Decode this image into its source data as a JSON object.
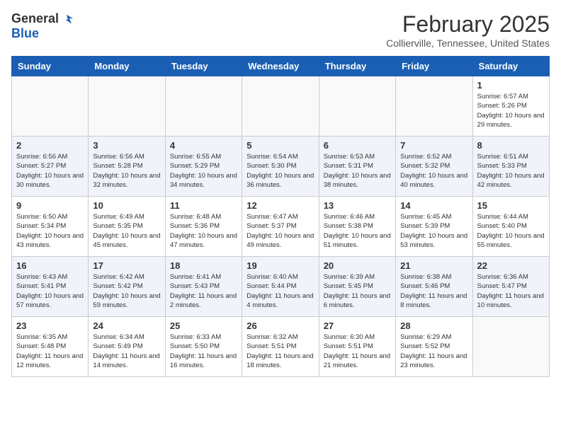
{
  "logo": {
    "general": "General",
    "blue": "Blue"
  },
  "title": "February 2025",
  "location": "Collierville, Tennessee, United States",
  "weekdays": [
    "Sunday",
    "Monday",
    "Tuesday",
    "Wednesday",
    "Thursday",
    "Friday",
    "Saturday"
  ],
  "weeks": [
    [
      {
        "day": "",
        "info": ""
      },
      {
        "day": "",
        "info": ""
      },
      {
        "day": "",
        "info": ""
      },
      {
        "day": "",
        "info": ""
      },
      {
        "day": "",
        "info": ""
      },
      {
        "day": "",
        "info": ""
      },
      {
        "day": "1",
        "info": "Sunrise: 6:57 AM\nSunset: 5:26 PM\nDaylight: 10 hours and 29 minutes."
      }
    ],
    [
      {
        "day": "2",
        "info": "Sunrise: 6:56 AM\nSunset: 5:27 PM\nDaylight: 10 hours and 30 minutes."
      },
      {
        "day": "3",
        "info": "Sunrise: 6:56 AM\nSunset: 5:28 PM\nDaylight: 10 hours and 32 minutes."
      },
      {
        "day": "4",
        "info": "Sunrise: 6:55 AM\nSunset: 5:29 PM\nDaylight: 10 hours and 34 minutes."
      },
      {
        "day": "5",
        "info": "Sunrise: 6:54 AM\nSunset: 5:30 PM\nDaylight: 10 hours and 36 minutes."
      },
      {
        "day": "6",
        "info": "Sunrise: 6:53 AM\nSunset: 5:31 PM\nDaylight: 10 hours and 38 minutes."
      },
      {
        "day": "7",
        "info": "Sunrise: 6:52 AM\nSunset: 5:32 PM\nDaylight: 10 hours and 40 minutes."
      },
      {
        "day": "8",
        "info": "Sunrise: 6:51 AM\nSunset: 5:33 PM\nDaylight: 10 hours and 42 minutes."
      }
    ],
    [
      {
        "day": "9",
        "info": "Sunrise: 6:50 AM\nSunset: 5:34 PM\nDaylight: 10 hours and 43 minutes."
      },
      {
        "day": "10",
        "info": "Sunrise: 6:49 AM\nSunset: 5:35 PM\nDaylight: 10 hours and 45 minutes."
      },
      {
        "day": "11",
        "info": "Sunrise: 6:48 AM\nSunset: 5:36 PM\nDaylight: 10 hours and 47 minutes."
      },
      {
        "day": "12",
        "info": "Sunrise: 6:47 AM\nSunset: 5:37 PM\nDaylight: 10 hours and 49 minutes."
      },
      {
        "day": "13",
        "info": "Sunrise: 6:46 AM\nSunset: 5:38 PM\nDaylight: 10 hours and 51 minutes."
      },
      {
        "day": "14",
        "info": "Sunrise: 6:45 AM\nSunset: 5:39 PM\nDaylight: 10 hours and 53 minutes."
      },
      {
        "day": "15",
        "info": "Sunrise: 6:44 AM\nSunset: 5:40 PM\nDaylight: 10 hours and 55 minutes."
      }
    ],
    [
      {
        "day": "16",
        "info": "Sunrise: 6:43 AM\nSunset: 5:41 PM\nDaylight: 10 hours and 57 minutes."
      },
      {
        "day": "17",
        "info": "Sunrise: 6:42 AM\nSunset: 5:42 PM\nDaylight: 10 hours and 59 minutes."
      },
      {
        "day": "18",
        "info": "Sunrise: 6:41 AM\nSunset: 5:43 PM\nDaylight: 11 hours and 2 minutes."
      },
      {
        "day": "19",
        "info": "Sunrise: 6:40 AM\nSunset: 5:44 PM\nDaylight: 11 hours and 4 minutes."
      },
      {
        "day": "20",
        "info": "Sunrise: 6:39 AM\nSunset: 5:45 PM\nDaylight: 11 hours and 6 minutes."
      },
      {
        "day": "21",
        "info": "Sunrise: 6:38 AM\nSunset: 5:46 PM\nDaylight: 11 hours and 8 minutes."
      },
      {
        "day": "22",
        "info": "Sunrise: 6:36 AM\nSunset: 5:47 PM\nDaylight: 11 hours and 10 minutes."
      }
    ],
    [
      {
        "day": "23",
        "info": "Sunrise: 6:35 AM\nSunset: 5:48 PM\nDaylight: 11 hours and 12 minutes."
      },
      {
        "day": "24",
        "info": "Sunrise: 6:34 AM\nSunset: 5:49 PM\nDaylight: 11 hours and 14 minutes."
      },
      {
        "day": "25",
        "info": "Sunrise: 6:33 AM\nSunset: 5:50 PM\nDaylight: 11 hours and 16 minutes."
      },
      {
        "day": "26",
        "info": "Sunrise: 6:32 AM\nSunset: 5:51 PM\nDaylight: 11 hours and 18 minutes."
      },
      {
        "day": "27",
        "info": "Sunrise: 6:30 AM\nSunset: 5:51 PM\nDaylight: 11 hours and 21 minutes."
      },
      {
        "day": "28",
        "info": "Sunrise: 6:29 AM\nSunset: 5:52 PM\nDaylight: 11 hours and 23 minutes."
      },
      {
        "day": "",
        "info": ""
      }
    ]
  ]
}
